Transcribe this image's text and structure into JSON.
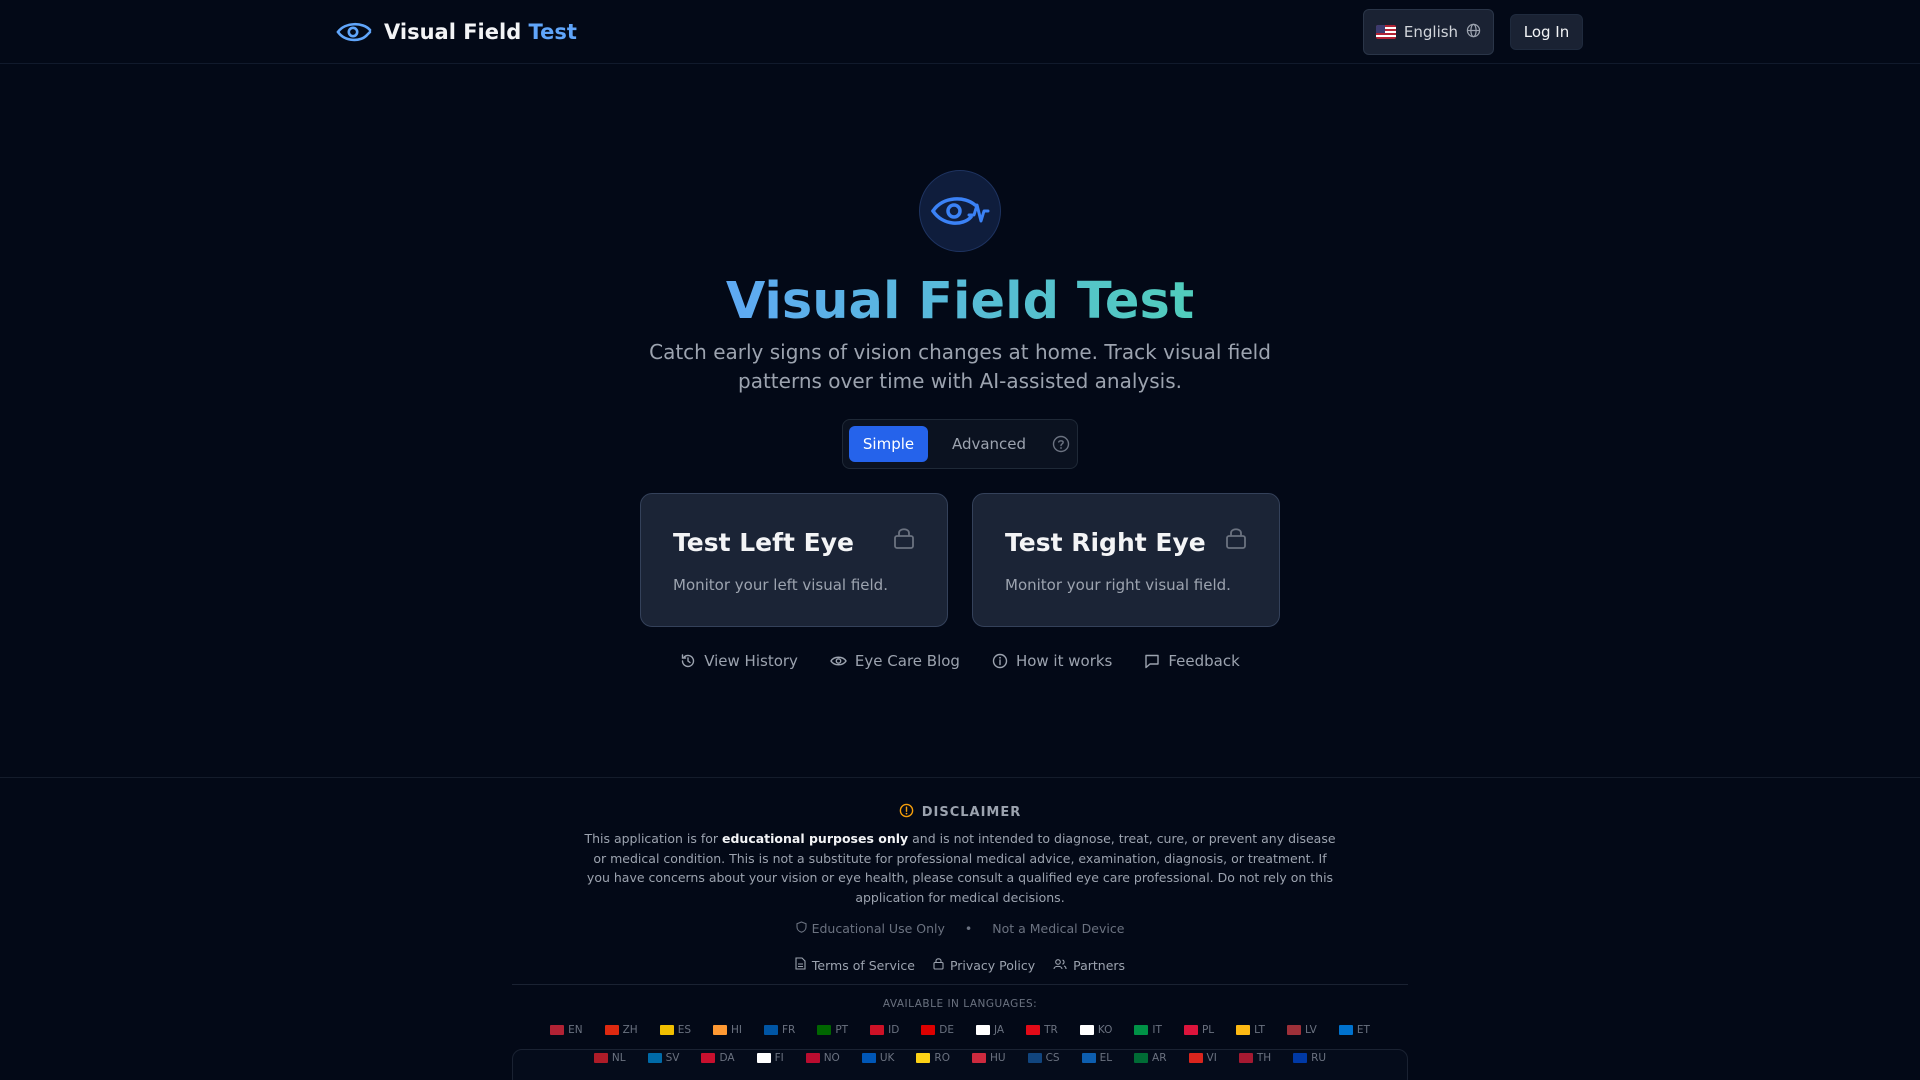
{
  "header": {
    "brand_main": "Visual Field",
    "brand_accent": "Test",
    "language_label": "English",
    "login_label": "Log In"
  },
  "hero": {
    "title": "Visual Field Test",
    "subtitle": "Catch early signs of vision changes at home. Track visual field patterns over time with AI-assisted analysis."
  },
  "mode": {
    "simple_label": "Simple",
    "advanced_label": "Advanced",
    "selected": "Simple"
  },
  "cards": {
    "left": {
      "title": "Test Left Eye",
      "description": "Monitor your left visual field."
    },
    "right": {
      "title": "Test Right Eye",
      "description": "Monitor your right visual field."
    }
  },
  "links": {
    "history": "View History",
    "blog": "Eye Care Blog",
    "how": "How it works",
    "feedback": "Feedback"
  },
  "footer": {
    "disclaimer_title": "DISCLAIMER",
    "disclaimer_prefix": "This application is for ",
    "disclaimer_bold": "educational purposes only",
    "disclaimer_rest": " and is not intended to diagnose, treat, cure, or prevent any disease or medical condition. This is not a substitute for professional medical advice, examination, diagnosis, or treatment. If you have concerns about your vision or eye health, please consult a qualified eye care professional. Do not rely on this application for medical decisions.",
    "badge_educational": "Educational Use Only",
    "badge_separator": "•",
    "badge_device": "Not a Medical Device",
    "terms": "Terms of Service",
    "privacy": "Privacy Policy",
    "partners": "Partners",
    "available_label": "AVAILABLE IN LANGUAGES:"
  },
  "languages_row1": [
    {
      "code": "EN",
      "color": "#b22234"
    },
    {
      "code": "ZH",
      "color": "#de2910"
    },
    {
      "code": "ES",
      "color": "#f1bf00"
    },
    {
      "code": "HI",
      "color": "#ff9933"
    },
    {
      "code": "FR",
      "color": "#0055a4"
    },
    {
      "code": "PT",
      "color": "#006600"
    },
    {
      "code": "ID",
      "color": "#ce1126"
    },
    {
      "code": "DE",
      "color": "#dd0000"
    },
    {
      "code": "JA",
      "color": "#ffffff"
    },
    {
      "code": "TR",
      "color": "#e30a17"
    },
    {
      "code": "KO",
      "color": "#ffffff"
    },
    {
      "code": "IT",
      "color": "#009246"
    },
    {
      "code": "PL",
      "color": "#dc143c"
    },
    {
      "code": "LT",
      "color": "#fdb913"
    },
    {
      "code": "LV",
      "color": "#9e3039"
    },
    {
      "code": "ET",
      "color": "#0072ce"
    }
  ],
  "languages_row2": [
    {
      "code": "NL",
      "color": "#ae1c28"
    },
    {
      "code": "SV",
      "color": "#006aa7"
    },
    {
      "code": "DA",
      "color": "#c8102e"
    },
    {
      "code": "FI",
      "color": "#ffffff"
    },
    {
      "code": "NO",
      "color": "#ba0c2f"
    },
    {
      "code": "UK",
      "color": "#0057b7"
    },
    {
      "code": "RO",
      "color": "#fcd116"
    },
    {
      "code": "HU",
      "color": "#cd2a3e"
    },
    {
      "code": "CS",
      "color": "#11457e"
    },
    {
      "code": "EL",
      "color": "#0d5eaf"
    },
    {
      "code": "AR",
      "color": "#006c35"
    },
    {
      "code": "VI",
      "color": "#da251d"
    },
    {
      "code": "TH",
      "color": "#a51931"
    },
    {
      "code": "RU",
      "color": "#0039a6"
    }
  ],
  "colors": {
    "accent": "#2563eb",
    "brand_blue": "#60a5fa",
    "brand_teal": "#4fd1b5",
    "background": "#030917",
    "card": "#1b2436",
    "warning": "#f59e0b"
  }
}
